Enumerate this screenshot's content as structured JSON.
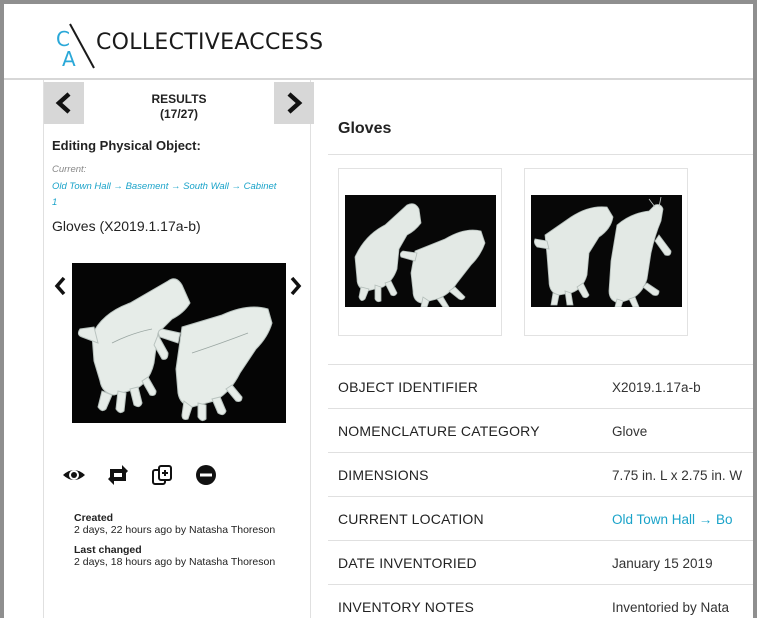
{
  "app": {
    "logo_mark": "CA",
    "name": "COLLECTIVEACCESS"
  },
  "sidebar": {
    "results_label": "RESULTS",
    "results_count": "(17/27)",
    "editing_title": "Editing Physical Object:",
    "current_label": "Current:",
    "current_path": "Old Town Hall → Basement → South Wall → Cabinet 1",
    "object_name": "Gloves (X2019.1.17a-b)",
    "actions": [
      {
        "name": "view-icon"
      },
      {
        "name": "swap-icon"
      },
      {
        "name": "duplicate-icon"
      },
      {
        "name": "delete-icon"
      }
    ],
    "created_label": "Created",
    "created_text": "2 days, 22 hours ago by Natasha Thoreson",
    "changed_label": "Last changed",
    "changed_text": "2 days, 18 hours ago by Natasha Thoreson"
  },
  "main": {
    "title": "Gloves",
    "thumbnails": [
      {
        "name": "gloves-image-1"
      },
      {
        "name": "gloves-image-2"
      }
    ],
    "fields": [
      {
        "label": "OBJECT IDENTIFIER",
        "value": "X2019.1.17a-b",
        "link": false
      },
      {
        "label": "NOMENCLATURE CATEGORY",
        "value": "Glove",
        "link": false
      },
      {
        "label": "DIMENSIONS",
        "value": "7.75 in. L x 2.75 in. W",
        "link": false
      },
      {
        "label": "CURRENT LOCATION",
        "value": "Old Town Hall → Bo",
        "link": true
      },
      {
        "label": "DATE INVENTORIED",
        "value": "January 15 2019",
        "link": false
      },
      {
        "label": "INVENTORY NOTES",
        "value": "Inventoried by Nata",
        "link": false
      }
    ]
  },
  "colors": {
    "link": "#1aa3c9",
    "nav_bg": "#d7d7d7",
    "border": "#8f8f8f"
  }
}
